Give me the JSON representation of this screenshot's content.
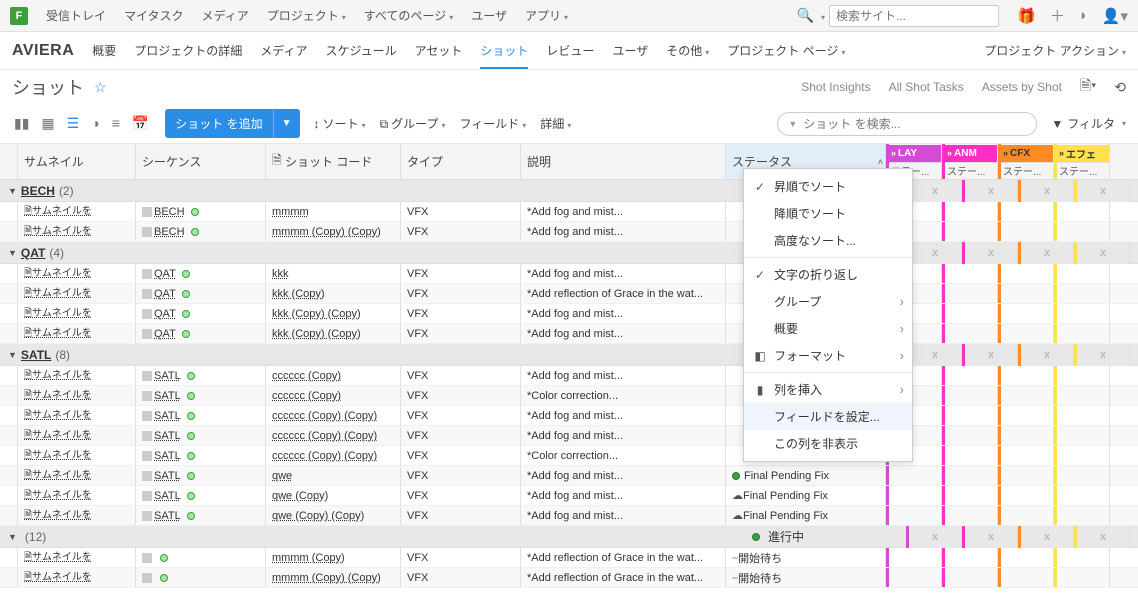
{
  "topbar": {
    "nav": [
      "受信トレイ",
      "マイタスク",
      "メディア",
      "プロジェクト",
      "すべてのページ",
      "ユーザ",
      "アプリ"
    ],
    "search_placeholder": "検索サイト..."
  },
  "project": {
    "title": "AVIERA",
    "nav": [
      "概要",
      "プロジェクトの詳細",
      "メディア",
      "スケジュール",
      "アセット",
      "ショット",
      "レビュー",
      "ユーザ",
      "その他",
      "プロジェクト ページ"
    ],
    "active_tab": "ショット",
    "right_label": "プロジェクト アクション"
  },
  "page": {
    "title": "ショット",
    "insights": "Shot Insights",
    "all_tasks": "All Shot Tasks",
    "assets_by": "Assets by Shot"
  },
  "toolbar": {
    "add_label": "ショット を追加",
    "sort": "ソート",
    "group": "グループ",
    "fields": "フィールド",
    "detail": "詳細",
    "search_placeholder": "ショット を検索...",
    "filter": "フィルタ"
  },
  "columns": {
    "thumb": "サムネイル",
    "seq": "シーケンス",
    "code": "ショット コード",
    "type": "タイプ",
    "desc": "説明",
    "status": "ステータス",
    "pipelines": [
      {
        "code": "LAY",
        "class": "lay",
        "sub": "ステー..."
      },
      {
        "code": "ANM",
        "class": "anm",
        "sub": "ステー..."
      },
      {
        "code": "CFX",
        "class": "cfx",
        "sub": "ステー..."
      },
      {
        "code": "エフェ",
        "class": "efx",
        "sub": "ステー..."
      }
    ]
  },
  "context_menu": {
    "sort_asc": "昇順でソート",
    "sort_desc": "降順でソート",
    "sort_adv": "高度なソート...",
    "wrap": "文字の折り返し",
    "group": "グループ",
    "summary": "概要",
    "format": "フォーマット",
    "insert": "列を挿入",
    "configure": "フィールドを設定...",
    "hide": "この列を非表示"
  },
  "status": {
    "pending_fix": "Final Pending Fix",
    "in_progress": "進行中",
    "waiting": "開始待ち"
  },
  "groups": [
    {
      "name": "BECH",
      "count": 2,
      "rows": [
        {
          "seq": "BECH",
          "code": "mmmm",
          "type": "VFX",
          "desc": "*Add fog and mist..."
        },
        {
          "seq": "BECH",
          "code": "mmmm (Copy) (Copy)",
          "type": "VFX",
          "desc": "*Add fog and mist..."
        }
      ]
    },
    {
      "name": "QAT",
      "count": 4,
      "rows": [
        {
          "seq": "QAT",
          "code": "kkk",
          "type": "VFX",
          "desc": "*Add fog and mist..."
        },
        {
          "seq": "QAT",
          "code": "kkk (Copy)",
          "type": "VFX",
          "desc": "*Add reflection of Grace in the wat..."
        },
        {
          "seq": "QAT",
          "code": "kkk (Copy) (Copy)",
          "type": "VFX",
          "desc": "*Add fog and mist..."
        },
        {
          "seq": "QAT",
          "code": "kkk (Copy) (Copy)",
          "type": "VFX",
          "desc": "*Add fog and mist..."
        }
      ]
    },
    {
      "name": "SATL",
      "count": 8,
      "rows": [
        {
          "seq": "SATL",
          "code": "cccccc (Copy)",
          "type": "VFX",
          "desc": "*Add fog and mist..."
        },
        {
          "seq": "SATL",
          "code": "cccccc (Copy)",
          "type": "VFX",
          "desc": "*Color correction..."
        },
        {
          "seq": "SATL",
          "code": "cccccc (Copy) (Copy)",
          "type": "VFX",
          "desc": "*Add fog and mist..."
        },
        {
          "seq": "SATL",
          "code": "cccccc (Copy) (Copy)",
          "type": "VFX",
          "desc": "*Add fog and mist..."
        },
        {
          "seq": "SATL",
          "code": "cccccc (Copy) (Copy)",
          "type": "VFX",
          "desc": "*Color correction..."
        },
        {
          "seq": "SATL",
          "code": "qwe",
          "type": "VFX",
          "desc": "*Add fog and mist...",
          "status": {
            "icon": "hold",
            "text": "Final Pending Fix"
          }
        },
        {
          "seq": "SATL",
          "code": "qwe (Copy)",
          "type": "VFX",
          "desc": "*Add fog and mist...",
          "status": {
            "icon": "bulb",
            "text": "Final Pending Fix"
          }
        },
        {
          "seq": "SATL",
          "code": "qwe (Copy) (Copy)",
          "type": "VFX",
          "desc": "*Add fog and mist...",
          "status": {
            "icon": "bulb",
            "text": "Final Pending Fix"
          }
        }
      ]
    },
    {
      "name": "",
      "count": 12,
      "status": {
        "icon": "hold",
        "text": "進行中"
      },
      "rows": [
        {
          "seq": "",
          "code": "mmmm (Copy)",
          "type": "VFX",
          "desc": "*Add reflection of Grace in the wat...",
          "status": {
            "icon": "dash",
            "text": "開始待ち"
          }
        },
        {
          "seq": "",
          "code": "mmmm (Copy) (Copy)",
          "type": "VFX",
          "desc": "*Add reflection of Grace in the wat...",
          "status": {
            "icon": "dash",
            "text": "開始待ち"
          }
        }
      ]
    }
  ],
  "thumb_label": "サムネイルを"
}
